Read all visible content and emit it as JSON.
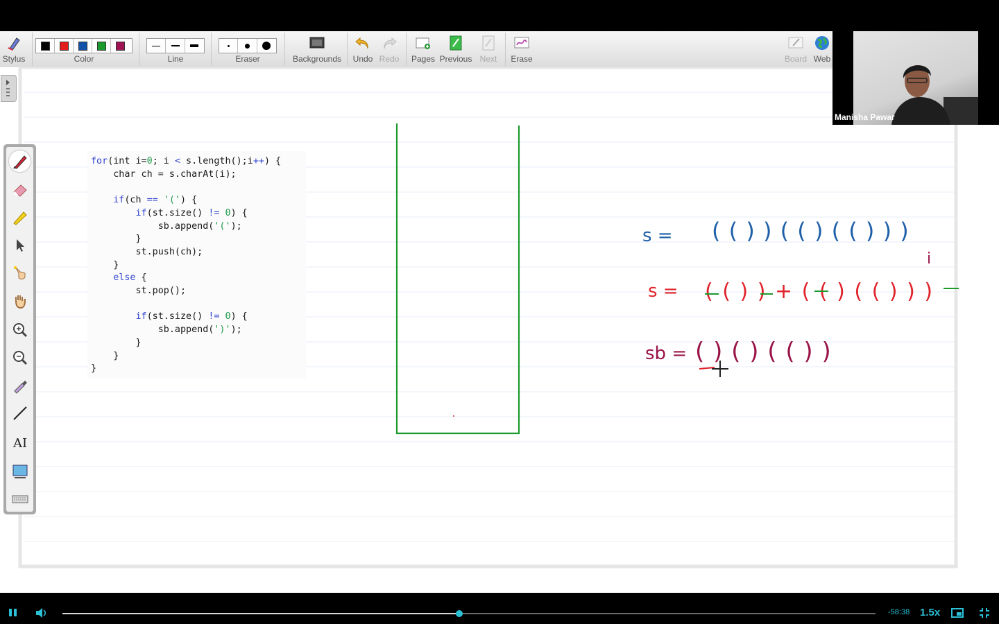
{
  "toolbar": {
    "stylus_label": "Stylus",
    "color_label": "Color",
    "line_label": "Line",
    "eraser_label": "Eraser",
    "backgrounds_label": "Backgrounds",
    "undo_label": "Undo",
    "redo_label": "Redo",
    "pages_label": "Pages",
    "previous_label": "Previous",
    "next_label": "Next",
    "erase_label": "Erase",
    "board_label": "Board",
    "web_label": "Web",
    "colors": [
      "#000000",
      "#e31c1c",
      "#1451a8",
      "#1c9a2e",
      "#a01454"
    ]
  },
  "video": {
    "participant_name": "Manisha Pawar"
  },
  "code": {
    "lines": [
      "for(int i=0; i < s.length();i++) {",
      "    char ch = s.charAt(i);",
      "",
      "    if(ch == '(') {",
      "        if(st.size() != 0) {",
      "            sb.append('(');",
      "        }",
      "        st.push(ch);",
      "    }",
      "    else {",
      "        st.pop();",
      "",
      "        if(st.size() != 0) {",
      "            sb.append(')');",
      "        }",
      "    }",
      "}"
    ]
  },
  "whiteboard": {
    "line1_label": "s =",
    "line1_value": "( ( ) ) ( ( ) ( ( ) ) )",
    "line1_pointer": "i",
    "line2_label": "s =",
    "line2_value": "( ( ) ) + ( ( ) ( ( ) ) )",
    "line3_label": "sb =",
    "line3_value": "( ) ( ) ( ( ) )",
    "ink_blue": "#1d5fa8",
    "ink_red": "#e0222a",
    "ink_green": "#1c9a2e",
    "ink_maroon": "#9a1448"
  },
  "player": {
    "time_remaining": "-58:38",
    "speed": "1.5x",
    "progress": 0.488
  }
}
